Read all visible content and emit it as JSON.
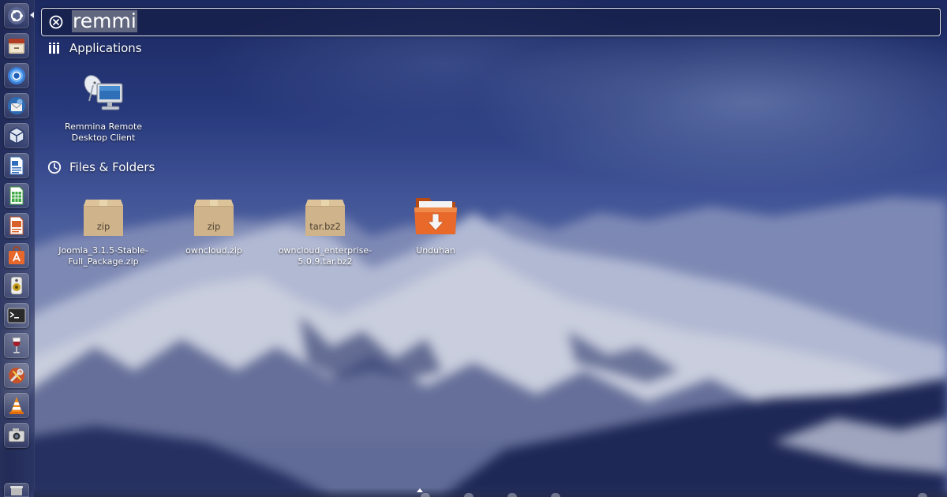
{
  "search": {
    "query": "remmi"
  },
  "launcher": {
    "items": [
      {
        "name": "dash-home",
        "icon": "ubuntu-logo-icon"
      },
      {
        "name": "file-manager",
        "icon": "file-cabinet-icon"
      },
      {
        "name": "chromium-browser",
        "icon": "chromium-icon"
      },
      {
        "name": "thunderbird-mail",
        "icon": "thunderbird-icon"
      },
      {
        "name": "virtualbox",
        "icon": "virtualbox-cube-icon"
      },
      {
        "name": "libreoffice-writer",
        "icon": "writer-document-icon"
      },
      {
        "name": "libreoffice-calc",
        "icon": "calc-spreadsheet-icon"
      },
      {
        "name": "libreoffice-impress",
        "icon": "impress-presentation-icon"
      },
      {
        "name": "ubuntu-software-center",
        "icon": "software-center-bag-icon"
      },
      {
        "name": "audio-player",
        "icon": "speaker-icon"
      },
      {
        "name": "terminal",
        "icon": "terminal-icon"
      },
      {
        "name": "wine",
        "icon": "wine-glass-icon"
      },
      {
        "name": "system-settings",
        "icon": "wrench-screwdriver-icon"
      },
      {
        "name": "vlc-player",
        "icon": "vlc-cone-icon"
      },
      {
        "name": "screenshot",
        "icon": "camera-icon"
      },
      {
        "name": "trash",
        "icon": "trash-bin-icon"
      }
    ]
  },
  "categories": {
    "applications": {
      "label": "Applications",
      "icon": "applications-grid-icon",
      "results": [
        {
          "label": "Remmina Remote Desktop Client",
          "icon": "remote-desktop-computer-icon"
        }
      ]
    },
    "files": {
      "label": "Files & Folders",
      "icon": "clock-recent-icon",
      "results": [
        {
          "label": "Joomla_3.1.5-Stable-Full_Package.zip",
          "icon": "archive-box-icon",
          "ext": "zip"
        },
        {
          "label": "owncloud.zip",
          "icon": "archive-box-icon",
          "ext": "zip"
        },
        {
          "label": "owncloud_enterprise-5.0.9.tar.bz2",
          "icon": "archive-box-icon",
          "ext": "tar.bz2"
        },
        {
          "label": "Unduhan",
          "icon": "downloads-folder-icon"
        }
      ]
    }
  },
  "colors": {
    "accent_orange": "#e05a1c",
    "archive_tan": "#cfb38a",
    "launcher_bg": "#1e264e"
  }
}
